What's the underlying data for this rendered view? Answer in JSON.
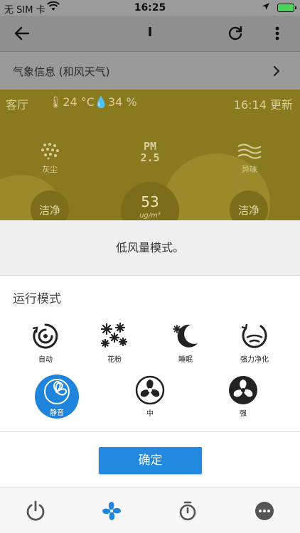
{
  "status_bar": {
    "carrier": "无 SIM 卡",
    "time": "16:25"
  },
  "app_bar": {
    "title": "I"
  },
  "weather": {
    "label": "气象信息 (和风天气)"
  },
  "room": {
    "name": "客厅",
    "temperature": "24 °C",
    "humidity": "34 %",
    "updated": "16:14 更新",
    "sensors": {
      "dust_label": "灰尘",
      "odor_label": "异味",
      "dust_status": "洁净",
      "odor_status": "洁净",
      "pm25_value": "53",
      "pm25_unit": "ug/m³"
    }
  },
  "sheet": {
    "hint": "低风量模式。",
    "mode_title": "运行模式",
    "modes": [
      {
        "label": "自动",
        "icon": "auto-icon",
        "selected": false
      },
      {
        "label": "花粉",
        "icon": "pollen-icon",
        "selected": false
      },
      {
        "label": "睡眠",
        "icon": "sleep-icon",
        "selected": false
      },
      {
        "label": "强力净化",
        "icon": "power-clean-icon",
        "selected": false
      },
      {
        "label": "静音",
        "icon": "fan-icon",
        "selected": true
      },
      {
        "label": "中",
        "icon": "fan-icon",
        "selected": false
      },
      {
        "label": "强",
        "icon": "fan-icon",
        "selected": false
      }
    ],
    "confirm_label": "确定"
  },
  "bottom_nav": {
    "items": [
      "power-icon",
      "fan-icon",
      "timer-icon",
      "more-icon"
    ],
    "active": "fan-icon"
  },
  "colors": {
    "accent": "#1f84dc",
    "room_bg": "#8a7a1f"
  }
}
